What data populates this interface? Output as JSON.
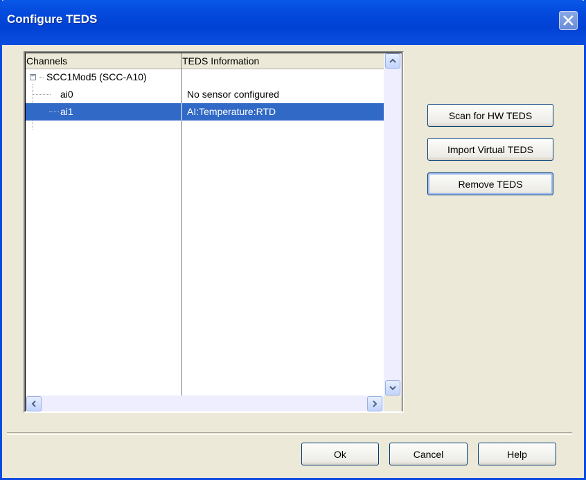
{
  "window": {
    "title": "Configure TEDS"
  },
  "grid": {
    "columns": [
      "Channels",
      "TEDS Information"
    ],
    "rows": [
      {
        "channel": "SCC1Mod5 (SCC-A10)",
        "info": "",
        "level": 0,
        "expanded": true,
        "selected": false
      },
      {
        "channel": "ai0",
        "info": "No sensor configured",
        "level": 1,
        "selected": false
      },
      {
        "channel": "ai1",
        "info": "AI:Temperature:RTD",
        "level": 1,
        "selected": true
      }
    ]
  },
  "side_buttons": {
    "scan": "Scan for HW TEDS",
    "import": "Import Virtual TEDS",
    "remove": "Remove TEDS"
  },
  "footer_buttons": {
    "ok": "Ok",
    "cancel": "Cancel",
    "help": "Help"
  },
  "icons": {
    "close": "close-icon",
    "expander": "minus-box-icon",
    "up": "arrow-up-icon",
    "down": "arrow-down-icon",
    "left": "arrow-left-icon",
    "right": "arrow-right-icon"
  },
  "colors": {
    "title_bar": "#0142d4",
    "selection": "#3169c6",
    "dialog_bg": "#ece9d8"
  }
}
